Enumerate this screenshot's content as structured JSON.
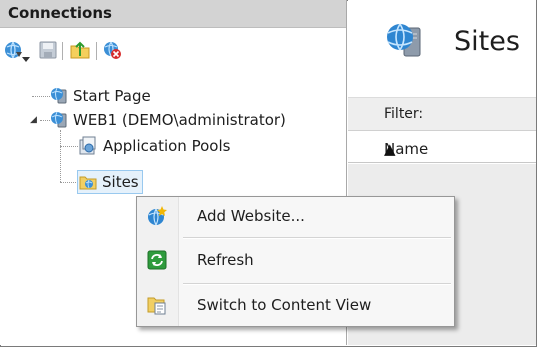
{
  "connections": {
    "header": "Connections",
    "toolbar": [
      {
        "icon": "connect-globe-icon",
        "has_dropdown": true
      },
      {
        "icon": "save-icon"
      },
      {
        "icon": "up-folder-icon"
      },
      {
        "icon": "disconnect-icon"
      }
    ],
    "tree": {
      "start_page": "Start Page",
      "server": "WEB1 (DEMO\\administrator)",
      "application_pools": "Application Pools",
      "sites": "Sites"
    }
  },
  "main": {
    "title": "Sites",
    "filter_label": "Filter:",
    "columns": [
      {
        "label": "Name",
        "sort": "ascending"
      }
    ]
  },
  "context_menu": {
    "items": [
      {
        "label": "Add Website...",
        "icon": "add-website-icon"
      },
      {
        "label": "Refresh",
        "icon": "refresh-icon"
      },
      {
        "label": "Switch to Content View",
        "icon": "content-view-icon"
      }
    ]
  },
  "colors": {
    "header_bg": "#d3d3d3",
    "selection": "#e5f1fb",
    "selection_border": "#99c9ef",
    "list_bg": "#ececec",
    "menu_bg": "#f7f7f7"
  }
}
